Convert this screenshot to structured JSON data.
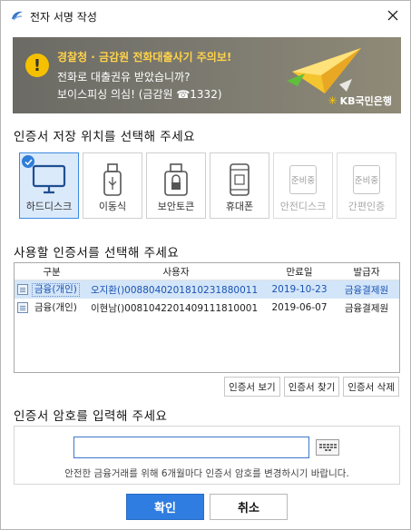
{
  "window": {
    "title": "전자 서명 작성",
    "close_icon": "close-icon"
  },
  "banner": {
    "line1": "경찰청 · 금감원 전화대출사기 주의보!",
    "line2": "전화로 대출권유 받았습니까?",
    "line3": "보이스피싱 의심! (금감원 ☎1332)",
    "brand": "KB국민은행",
    "colors": {
      "highlight": "#ffd34a",
      "warning": "#f5c000"
    }
  },
  "storage": {
    "heading": "인증서 저장 위치를 선택해 주세요",
    "options": [
      {
        "label": "하드디스크",
        "icon": "monitor-icon",
        "state": "selected"
      },
      {
        "label": "이동식",
        "icon": "usb-icon",
        "state": "enabled"
      },
      {
        "label": "보안토큰",
        "icon": "security-token-icon",
        "state": "enabled"
      },
      {
        "label": "휴대폰",
        "icon": "phone-icon",
        "state": "enabled"
      },
      {
        "label": "안전디스크",
        "icon": "pending-icon",
        "badge": "준비중",
        "state": "disabled"
      },
      {
        "label": "간편인증",
        "icon": "pending-icon",
        "badge": "준비중",
        "state": "disabled"
      }
    ]
  },
  "certs": {
    "heading": "사용할 인증서를 선택해 주세요",
    "columns": [
      "구분",
      "사용자",
      "만료일",
      "발급자"
    ],
    "rows": [
      {
        "type": "금융(개인)",
        "user": "오지환()0088040201810231880011",
        "expiry": "2019-10-23",
        "issuer": "금융결제원",
        "selected": true
      },
      {
        "type": "금융(개인)",
        "user": "이현남()0081042201409111810001",
        "expiry": "2019-06-07",
        "issuer": "금융결제원",
        "selected": false
      }
    ],
    "actions": {
      "view": "인증서 보기",
      "find": "인증서 찾기",
      "delete": "인증서 삭제"
    }
  },
  "password": {
    "heading": "인증서 암호를 입력해 주세요",
    "value": "",
    "hint": "안전한 금융거래를 위해 6개월마다 인증서 암호를 변경하시기 바랍니다."
  },
  "buttons": {
    "ok": "확인",
    "cancel": "취소"
  },
  "accent": "#2f7de1"
}
